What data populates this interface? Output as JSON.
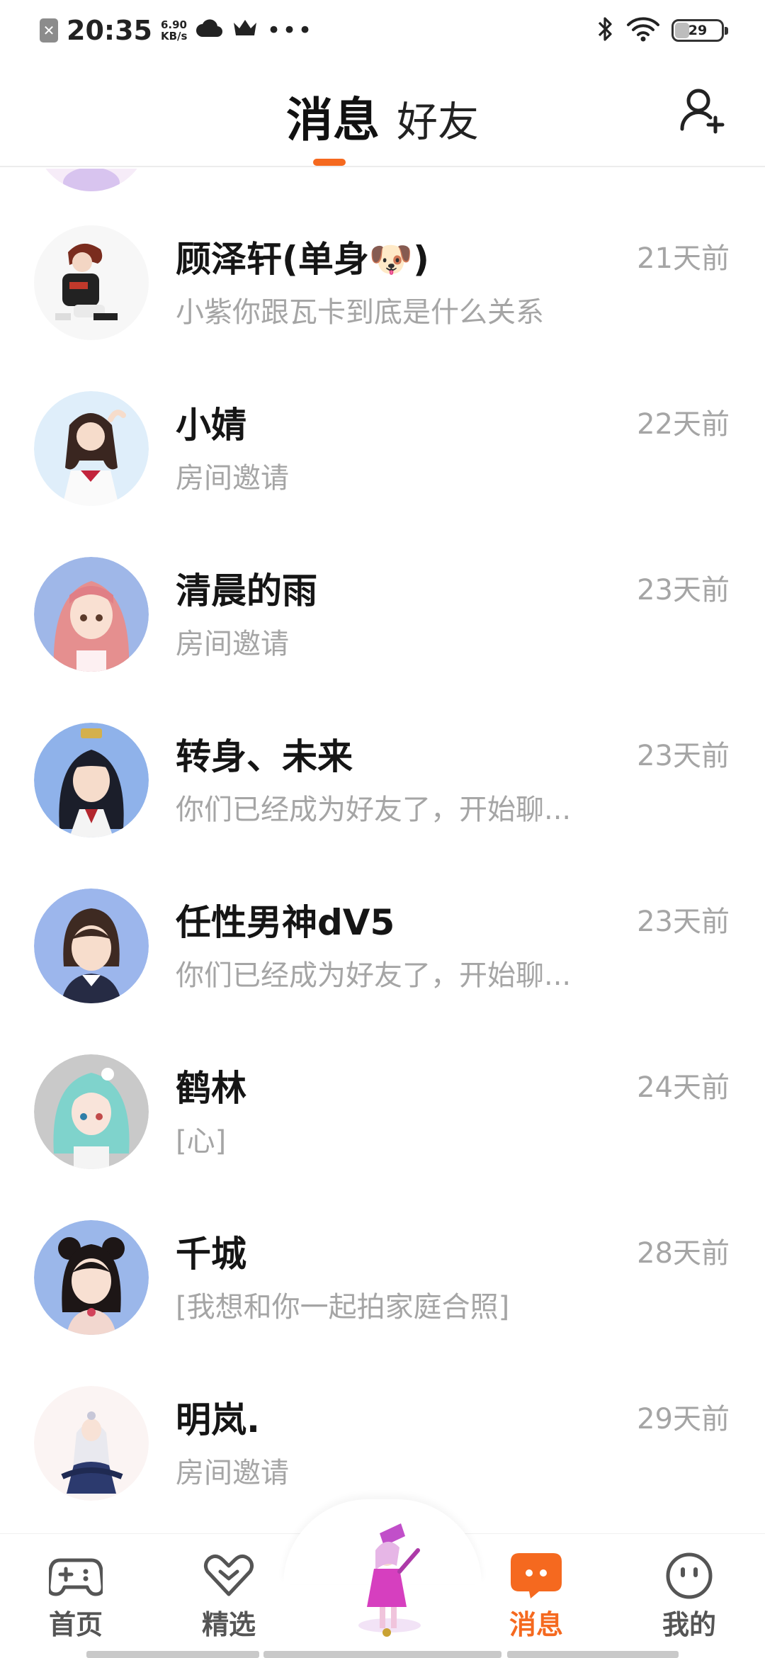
{
  "status_bar": {
    "time": "20:35",
    "speed_value": "6.90",
    "speed_unit": "KB/s",
    "battery": "29",
    "battery_level": 0.29,
    "icons": [
      "close-badge-icon",
      "cloud-icon",
      "crown-icon",
      "more-dots-icon",
      "bluetooth-icon",
      "wifi-icon",
      "battery-icon"
    ]
  },
  "header": {
    "tab_messages": "消息",
    "tab_friends": "好友",
    "add_friend_icon": "add-user-icon",
    "accent": "#f5691f"
  },
  "conversations": [
    {
      "name": "顾泽轩(单身🐶)",
      "message": "小紫你跟瓦卡到底是什么关系",
      "time": "21天前"
    },
    {
      "name": "小婧",
      "message": "房间邀请",
      "time": "22天前"
    },
    {
      "name": "清晨的雨",
      "message": "房间邀请",
      "time": "23天前"
    },
    {
      "name": "转身、未来",
      "message": "你们已经成为好友了，开始聊...",
      "time": "23天前"
    },
    {
      "name": "任性男神dV5",
      "message": "你们已经成为好友了，开始聊...",
      "time": "23天前"
    },
    {
      "name": "鹤林",
      "message": "[心]",
      "time": "24天前"
    },
    {
      "name": "千城",
      "message": "[我想和你一起拍家庭合照]",
      "time": "28天前"
    },
    {
      "name": "明岚.",
      "message": "房间邀请",
      "time": "29天前"
    }
  ],
  "bottom_nav": {
    "home": "首页",
    "featured": "精选",
    "messages": "消息",
    "mine": "我的"
  }
}
